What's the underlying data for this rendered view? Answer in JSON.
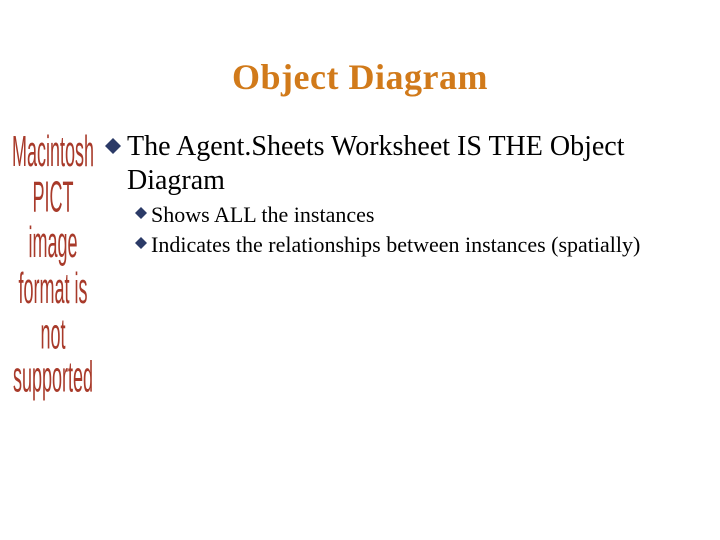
{
  "title": {
    "text": "Object Diagram",
    "color": "#d17a1a"
  },
  "placeholder": {
    "text": "Macintosh PICT image format is not supported",
    "color": "#a83a2a"
  },
  "bullets": {
    "level1": [
      {
        "text": "The Agent.Sheets Worksheet IS THE Object Diagram",
        "children": [
          {
            "text": "Shows ALL the instances"
          },
          {
            "text": "Indicates the relationships between instances (spatially)"
          }
        ]
      }
    ],
    "bullet_color": "#2b3a67"
  }
}
